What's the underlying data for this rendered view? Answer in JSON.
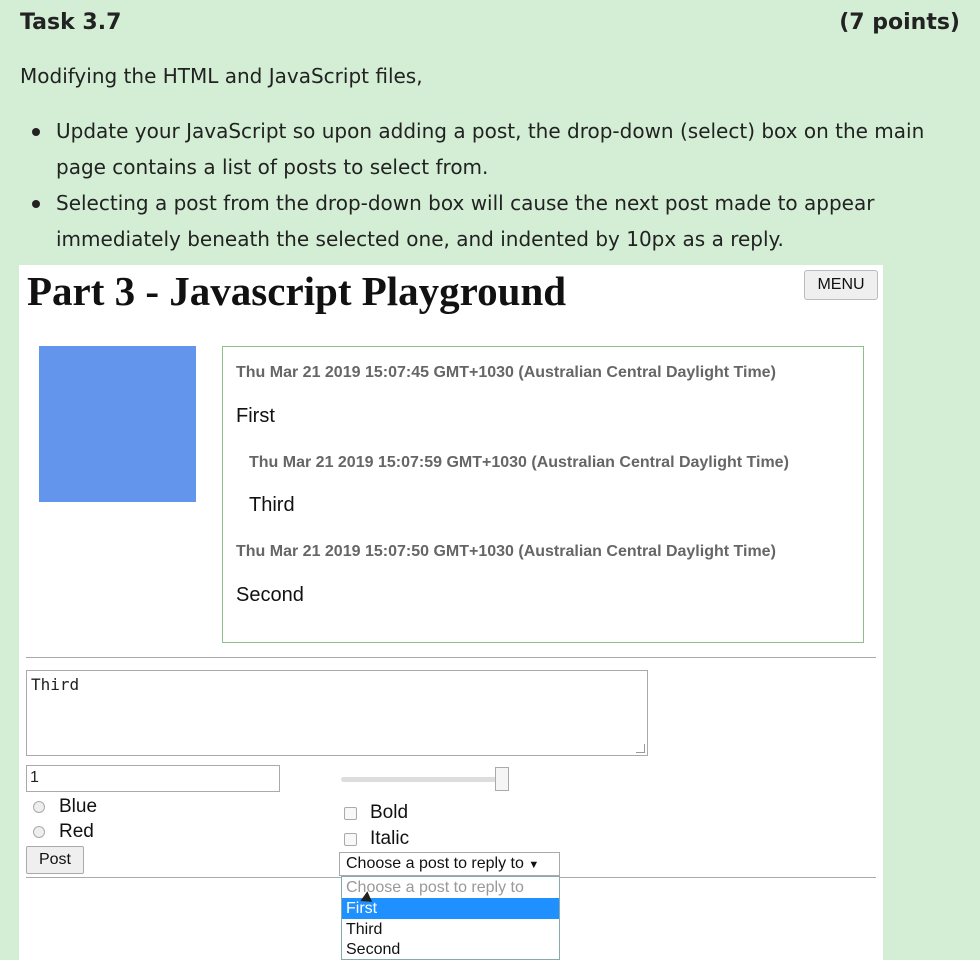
{
  "task": {
    "title": "Task 3.7",
    "points": "(7 points)"
  },
  "intro": "Modifying the HTML and JavaScript files,",
  "bullets": [
    {
      "line1": "Update your JavaScript so upon adding a post, the drop-down (select) box on the main",
      "line2": "page contains a list of posts to select from."
    },
    {
      "line1": "Selecting a post from the drop-down box will cause the next post made to appear",
      "line2": "immediately beneath the selected one, and indented by 10px as a reply."
    }
  ],
  "app": {
    "heading": "Part 3 - Javascript Playground",
    "menu_label": "MENU",
    "square_color": "#6495ed",
    "posts": [
      {
        "timestamp": "Thu Mar 21 2019 15:07:45 GMT+1030 (Australian Central Daylight Time)",
        "text": "First",
        "indent": false
      },
      {
        "timestamp": "Thu Mar 21 2019 15:07:59 GMT+1030 (Australian Central Daylight Time)",
        "text": "Third",
        "indent": true
      },
      {
        "timestamp": "Thu Mar 21 2019 15:07:50 GMT+1030 (Australian Central Daylight Time)",
        "text": "Second",
        "indent": false
      }
    ],
    "textarea_value": "Third",
    "number_value": "1",
    "slider_value": 1,
    "radios": [
      {
        "label": "Blue",
        "checked": false
      },
      {
        "label": "Red",
        "checked": false
      }
    ],
    "checkboxes": [
      {
        "label": "Bold",
        "checked": false
      },
      {
        "label": "Italic",
        "checked": false
      }
    ],
    "post_button": "Post",
    "select": {
      "selected": "Choose a post to reply to",
      "options": [
        {
          "label": "Choose a post to reply to",
          "disabled": true
        },
        {
          "label": "First",
          "highlighted": true
        },
        {
          "label": "Third"
        },
        {
          "label": "Second"
        }
      ]
    }
  }
}
